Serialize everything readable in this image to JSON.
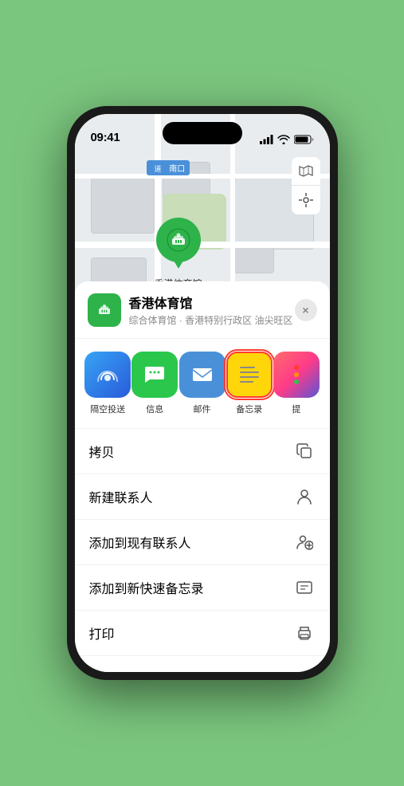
{
  "status_bar": {
    "time": "09:41",
    "signal_bars": "signal-icon",
    "wifi": "wifi-icon",
    "battery": "battery-icon"
  },
  "map": {
    "road_label": "南口",
    "controls": {
      "map_type": "map-type-icon",
      "location": "location-icon"
    }
  },
  "pin": {
    "label": "香港体育馆"
  },
  "location_header": {
    "name": "香港体育馆",
    "description": "综合体育馆 · 香港特别行政区 油尖旺区",
    "close_label": "×"
  },
  "share_items": [
    {
      "id": "airdrop",
      "label": "隔空投送",
      "style": "airdrop"
    },
    {
      "id": "messages",
      "label": "信息",
      "style": "messages"
    },
    {
      "id": "mail",
      "label": "邮件",
      "style": "mail"
    },
    {
      "id": "notes",
      "label": "备忘录",
      "style": "notes"
    },
    {
      "id": "more",
      "label": "提",
      "style": "more"
    }
  ],
  "actions": [
    {
      "id": "copy",
      "label": "拷贝",
      "icon": "copy-icon"
    },
    {
      "id": "new-contact",
      "label": "新建联系人",
      "icon": "new-contact-icon"
    },
    {
      "id": "add-contact",
      "label": "添加到现有联系人",
      "icon": "add-contact-icon"
    },
    {
      "id": "add-note",
      "label": "添加到新快速备忘录",
      "icon": "add-note-icon"
    },
    {
      "id": "print",
      "label": "打印",
      "icon": "print-icon"
    }
  ]
}
